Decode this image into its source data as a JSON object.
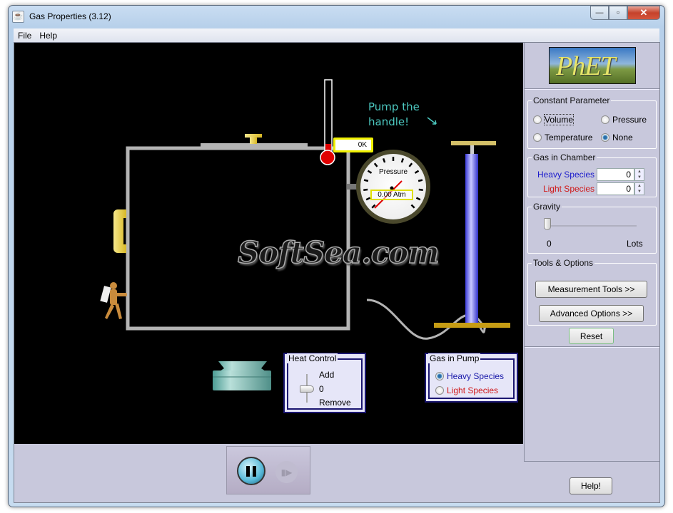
{
  "window": {
    "title": "Gas Properties (3.12)",
    "controls": {
      "minimize": "—",
      "maximize": "▫",
      "close": "✕"
    }
  },
  "menu": [
    {
      "label": "File"
    },
    {
      "label": "Help"
    }
  ],
  "stage": {
    "hint": [
      "Pump the",
      "handle!"
    ],
    "thermometer": {
      "readout": "0K"
    },
    "pressure_gauge": {
      "label": "Pressure",
      "readout": "0.00 Atm"
    },
    "watermark": "SoftSea.com",
    "heat_control": {
      "title": "Heat Control",
      "add_label": "Add",
      "zero_label": "0",
      "remove_label": "Remove",
      "value": 0
    },
    "gas_in_pump": {
      "title": "Gas in Pump",
      "options": [
        {
          "label": "Heavy Species",
          "selected": true,
          "color": "#1a1aaa"
        },
        {
          "label": "Light Species",
          "selected": false,
          "color": "#d01818"
        }
      ]
    }
  },
  "sidebar": {
    "logo": "PhET",
    "constant_parameter": {
      "title": "Constant Parameter",
      "options": [
        {
          "label": "Volume",
          "selected": false
        },
        {
          "label": "Pressure",
          "selected": false
        },
        {
          "label": "Temperature",
          "selected": false
        },
        {
          "label": "None",
          "selected": true
        }
      ]
    },
    "gas_in_chamber": {
      "title": "Gas in Chamber",
      "heavy": {
        "label": "Heavy Species",
        "value": "0",
        "color": "#1a1acc"
      },
      "light": {
        "label": "Light Species",
        "value": "0",
        "color": "#d01818"
      }
    },
    "gravity": {
      "title": "Gravity",
      "min_label": "0",
      "max_label": "Lots",
      "value": 0
    },
    "tools": {
      "title": "Tools & Options",
      "measurement": "Measurement Tools >>",
      "advanced": "Advanced Options >>"
    },
    "reset": "Reset",
    "help": "Help!"
  },
  "clock": {
    "pause": "pause",
    "step": "step"
  }
}
